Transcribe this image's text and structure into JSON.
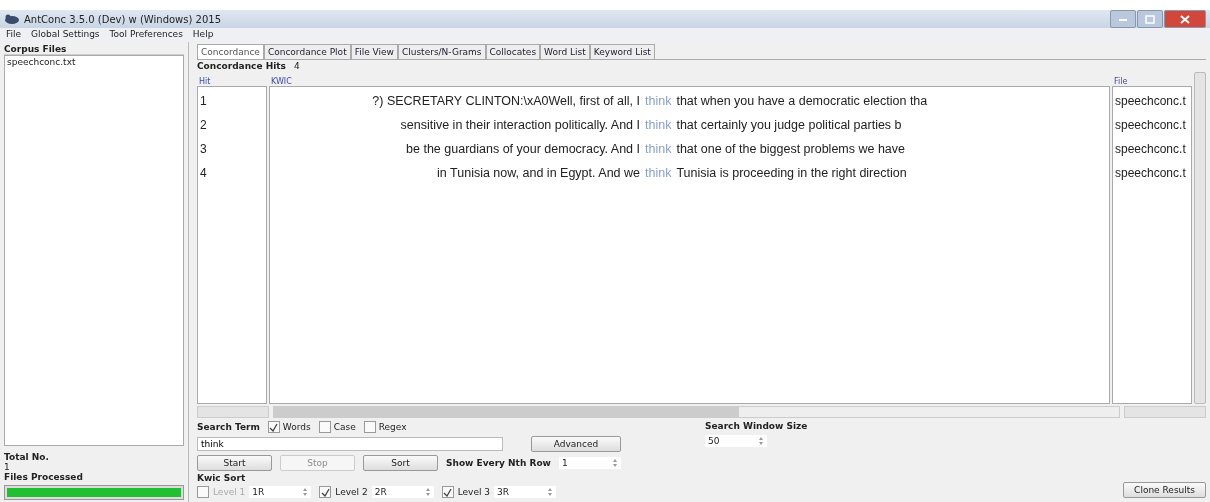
{
  "window": {
    "title": "AntConc 3.5.0 (Dev) w (Windows) 2015"
  },
  "menu": [
    "File",
    "Global Settings",
    "Tool Preferences",
    "Help"
  ],
  "sidebar": {
    "title": "Corpus Files",
    "files": [
      "speechconc.txt"
    ],
    "total_label": "Total No.",
    "total_value": "1",
    "processed_label": "Files Processed",
    "progress": {
      "level": 1
    }
  },
  "tabs": [
    {
      "label": "Concordance",
      "selected": true
    },
    {
      "label": "Concordance Plot",
      "selected": false
    },
    {
      "label": "File View",
      "selected": false
    },
    {
      "label": "Clusters/N-Grams",
      "selected": false
    },
    {
      "label": "Collocates",
      "selected": false
    },
    {
      "label": "Word List",
      "selected": false
    },
    {
      "label": "Keyword List",
      "selected": false
    }
  ],
  "hits": {
    "label": "Concordance Hits",
    "value": "4"
  },
  "table": {
    "columns": [
      "Hit",
      "KWIC",
      "File"
    ],
    "rows": [
      {
        "hit": "1",
        "left": "?) SECRETARY CLINTON:\\xA0Well, first of all, I",
        "keyword": "think",
        "right": "that when you have a democratic election tha",
        "file": "speechconc.t"
      },
      {
        "hit": "2",
        "left": "sensitive in their interaction politically. And I",
        "keyword": "think",
        "right": "that certainly you judge political parties b",
        "file": "speechconc.t"
      },
      {
        "hit": "3",
        "left": "be the guardians of your democracy. And I",
        "keyword": "think",
        "right": "that one of the biggest problems we have",
        "file": "speechconc.t"
      },
      {
        "hit": "4",
        "left": "in Tunisia now, and in Egypt. And we",
        "keyword": "think",
        "right": "Tunisia is proceeding in the right direction",
        "file": "speechconc.t"
      }
    ]
  },
  "search": {
    "label": "Search Term",
    "options": [
      {
        "label": "Words",
        "checked": true
      },
      {
        "label": "Case",
        "checked": false
      },
      {
        "label": "Regex",
        "checked": false
      }
    ],
    "value": "think",
    "advanced": "Advanced"
  },
  "buttons": [
    {
      "label": "Start",
      "disabled": false
    },
    {
      "label": "Stop",
      "disabled": true
    },
    {
      "label": "Sort",
      "disabled": false
    }
  ],
  "nth_row": {
    "label": "Show Every Nth Row",
    "value": "1"
  },
  "window_size": {
    "label": "Search Window Size",
    "value": "50"
  },
  "kwic_sort": {
    "label": "Kwic Sort",
    "levels": [
      {
        "label": "Level 1",
        "value": "1R",
        "checked": false
      },
      {
        "label": "Level 2",
        "value": "2R",
        "checked": true
      },
      {
        "label": "Level 3",
        "value": "3R",
        "checked": true
      }
    ]
  },
  "clone": "Clone Results"
}
